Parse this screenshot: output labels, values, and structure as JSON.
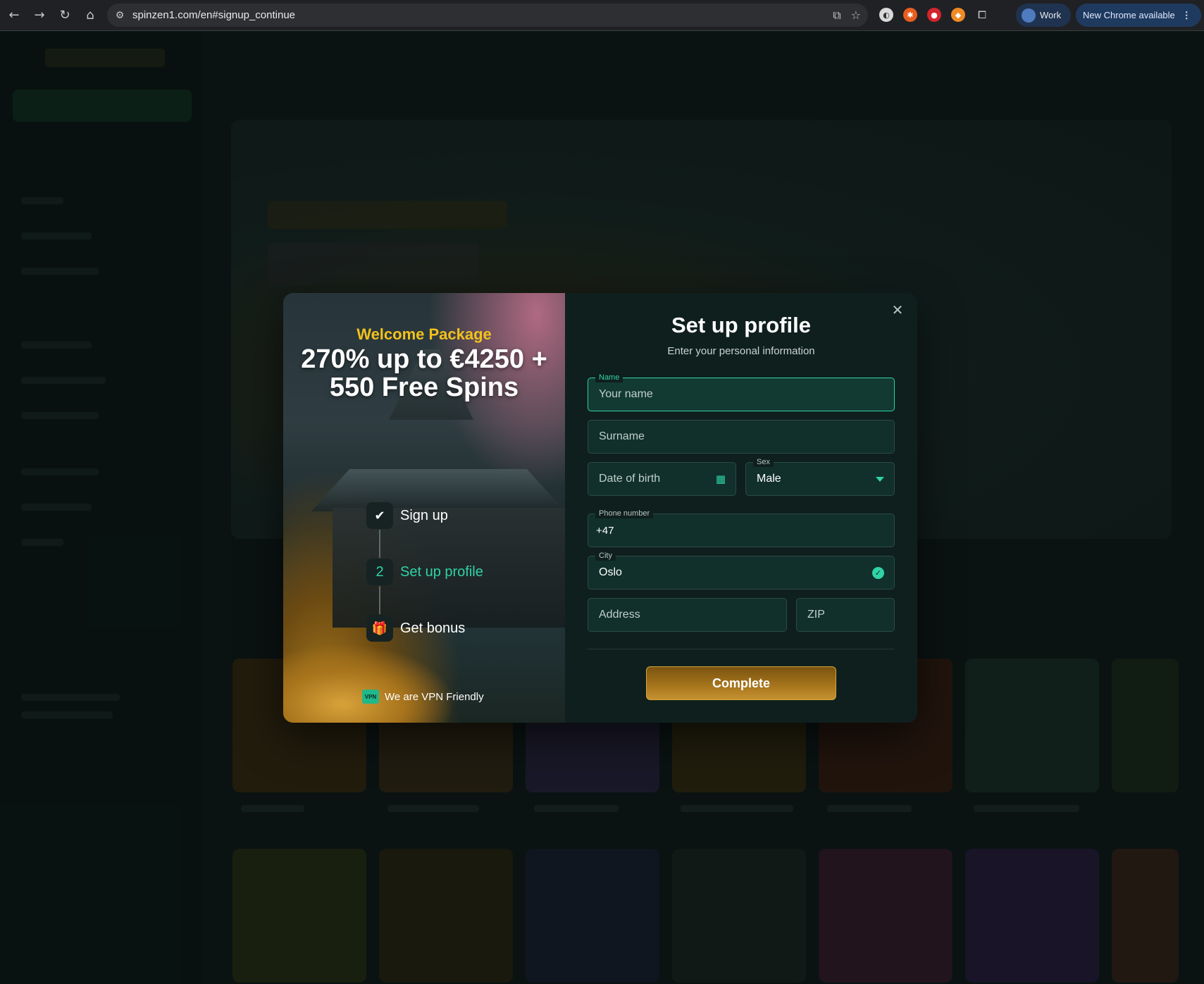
{
  "browser": {
    "url": "spinzen1.com/en#signup_continue",
    "profile_label": "Work",
    "update_label": "New Chrome available",
    "icons": [
      "back-icon",
      "forward-icon",
      "reload-icon",
      "home-icon",
      "site-settings-icon",
      "install-icon",
      "bookmark-star-icon"
    ]
  },
  "promo": {
    "kicker": "Welcome Package",
    "headline": "270% up to €4250 + 550 Free Spins",
    "steps": [
      {
        "badge": "✔",
        "label": "Sign up",
        "state": "done"
      },
      {
        "badge": "2",
        "label": "Set up profile",
        "state": "active"
      },
      {
        "badge": "🎁",
        "label": "Get bonus",
        "state": "pending"
      }
    ],
    "vpn_badge": "VPN",
    "vpn_text": "We are VPN Friendly"
  },
  "form": {
    "title": "Set up profile",
    "subtitle": "Enter your personal information",
    "close_icon": "✕",
    "name": {
      "label": "Name",
      "placeholder": "Your name"
    },
    "surname": {
      "placeholder": "Surname"
    },
    "dob": {
      "placeholder": "Date of birth",
      "icon": "▦"
    },
    "sex": {
      "label": "Sex",
      "value": "Male"
    },
    "phone": {
      "label": "Phone number",
      "value": "+47"
    },
    "city": {
      "label": "City",
      "value": "Oslo",
      "valid_icon": "✓"
    },
    "address": {
      "placeholder": "Address"
    },
    "zip": {
      "placeholder": "ZIP"
    },
    "submit_label": "Complete"
  },
  "colors": {
    "accent": "#2fd3a5",
    "gold": "#f2c21b",
    "panel": "#0f1f1d",
    "button": "#a8761d"
  }
}
